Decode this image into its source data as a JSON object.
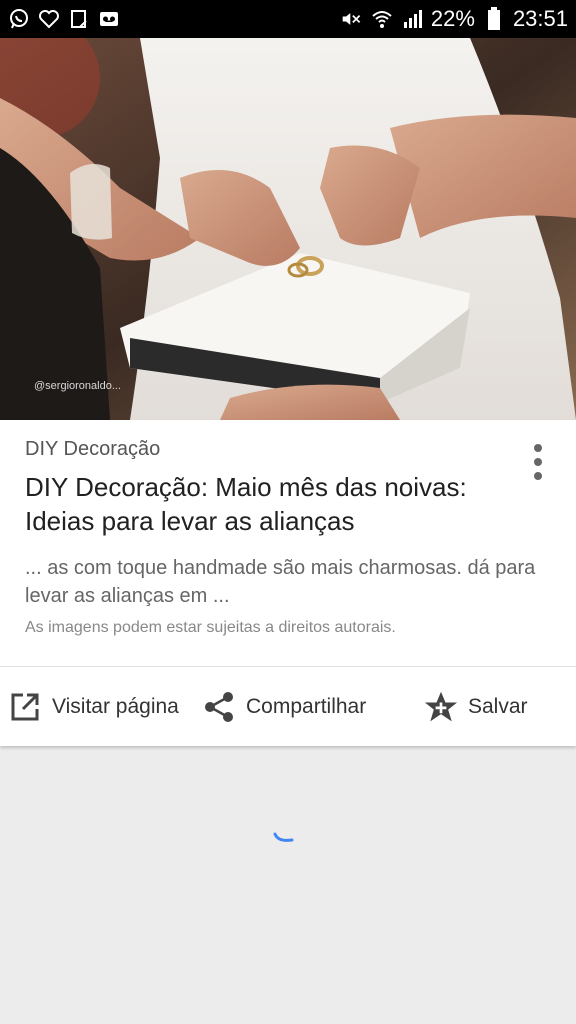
{
  "status_bar": {
    "battery": "22%",
    "time": "23:51",
    "left_icons": [
      "whatsapp-icon",
      "heart-icon",
      "clipboard-icon",
      "voicemail-icon"
    ],
    "right_icons": [
      "mute-icon",
      "wifi-icon",
      "signal-icon",
      "battery-icon"
    ]
  },
  "hero": {
    "watermark": "@sergioronaldo..."
  },
  "card": {
    "source": "DIY Decoração",
    "title": "DIY Decoração: Maio mês das noivas: Ideias para levar as alianças",
    "snippet": "... as com toque handmade são mais charmosas. dá para levar as alianças em ...",
    "notice": "As imagens podem estar sujeitas a direitos autorais."
  },
  "actions": {
    "visit": "Visitar página",
    "share": "Compartilhar",
    "save": "Salvar"
  },
  "colors": {
    "status_bar": "#000000",
    "background": "#ececec",
    "spinner": "#4285f4"
  }
}
